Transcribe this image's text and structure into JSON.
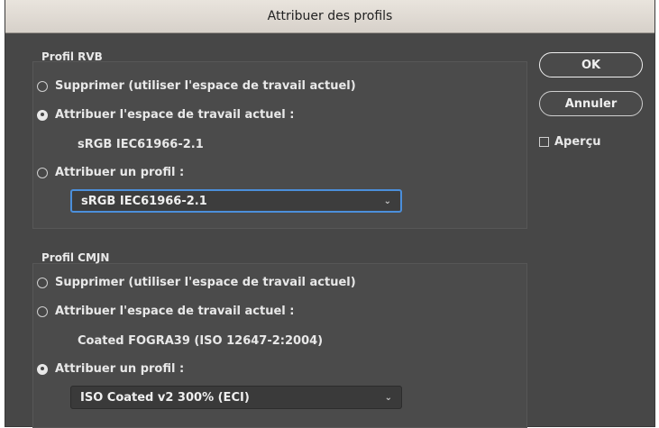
{
  "window": {
    "title": "Attribuer des profils"
  },
  "rgb": {
    "group_label": "Profil RVB",
    "options": [
      {
        "label": "Supprimer (utiliser l'espace de travail actuel)",
        "checked": false
      },
      {
        "label": "Attribuer l'espace de travail actuel :",
        "checked": true
      },
      {
        "label": "Attribuer un profil :",
        "checked": false
      }
    ],
    "current_space": "sRGB IEC61966-2.1",
    "profile_select": "sRGB IEC61966-2.1"
  },
  "cmyk": {
    "group_label": "Profil CMJN",
    "options": [
      {
        "label": "Supprimer (utiliser l'espace de travail actuel)",
        "checked": false
      },
      {
        "label": "Attribuer l'espace de travail actuel :",
        "checked": false
      },
      {
        "label": "Attribuer un profil :",
        "checked": true
      }
    ],
    "current_space": "Coated FOGRA39 (ISO 12647-2:2004)",
    "profile_select": "ISO Coated v2 300% (ECI)"
  },
  "buttons": {
    "ok": "OK",
    "cancel": "Annuler"
  },
  "preview": {
    "label": "Aperçu",
    "checked": false
  },
  "colors": {
    "dialog_bg": "#474747",
    "focus": "#4b8fdb"
  }
}
